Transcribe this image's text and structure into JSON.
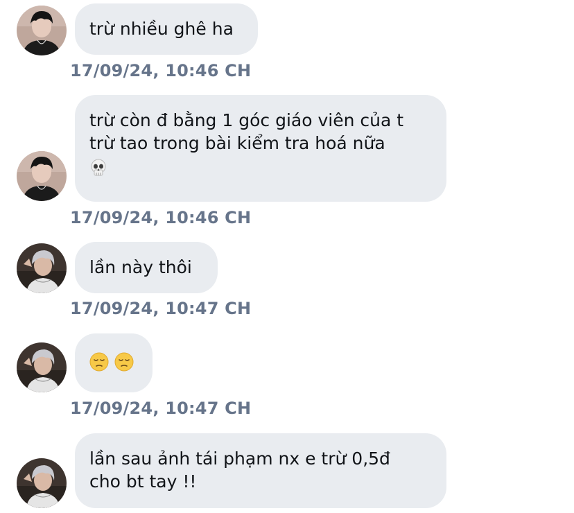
{
  "messages": [
    {
      "sender_avatar": "avatar-dark-hair",
      "lines": [
        "trừ nhiều ghê ha"
      ],
      "timestamp": "17/09/24, 10:46 CH"
    },
    {
      "sender_avatar": "avatar-dark-hair",
      "lines": [
        "trừ còn đ bằng 1 góc giáo viên của t",
        "trừ tao trong bài kiểm tra hoá nữa"
      ],
      "emoji": [
        "skull-emoji"
      ],
      "timestamp": "17/09/24, 10:46 CH"
    },
    {
      "sender_avatar": "avatar-silver-hair",
      "lines": [
        "lần này thôi"
      ],
      "timestamp": "17/09/24, 10:47 CH"
    },
    {
      "sender_avatar": "avatar-silver-hair",
      "emoji": [
        "pensive-face-emoji",
        "pensive-face-emoji"
      ],
      "timestamp": "17/09/24, 10:47 CH"
    },
    {
      "sender_avatar": "avatar-silver-hair",
      "lines": [
        "lần sau ảnh tái phạm nx e trừ 0,5đ",
        "cho bt tay !!"
      ]
    }
  ],
  "colors": {
    "bubble_background": "#e9ecf0",
    "message_text": "#111418",
    "timestamp_text": "#66748a"
  }
}
